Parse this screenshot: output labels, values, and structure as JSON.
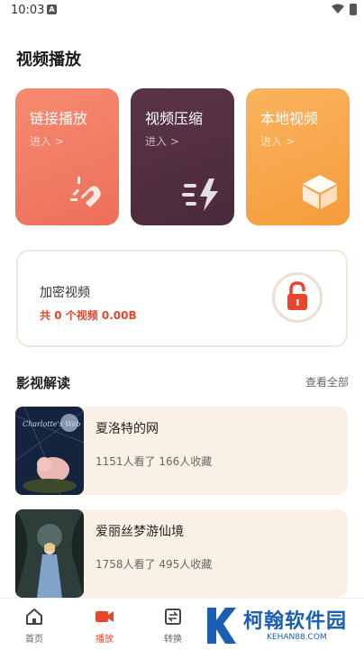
{
  "status": {
    "time": "10:03"
  },
  "video_section": {
    "title": "视频播放",
    "cards": [
      {
        "title": "链接播放",
        "sub": "进入 >",
        "icon": "magnet-icon",
        "color": "#f0765f"
      },
      {
        "title": "视频压缩",
        "sub": "进入 >",
        "icon": "lightning-icon",
        "color": "#502f40"
      },
      {
        "title": "本地视频",
        "sub": "进入 >",
        "icon": "cube-icon",
        "color": "#f8a64a"
      }
    ]
  },
  "encrypted": {
    "title": "加密视频",
    "stat": "共 0 个视频 0.00B",
    "icon": "lock-icon"
  },
  "film_section": {
    "title": "影视解读",
    "view_all": "查看全部",
    "items": [
      {
        "title": "夏洛特的网",
        "stat": "1151人看了 166人收藏",
        "poster_text": "Charlotte's Web"
      },
      {
        "title": "爱丽丝梦游仙境",
        "stat": "1758人看了 495人收藏"
      }
    ]
  },
  "tabbar": {
    "items": [
      {
        "label": "首页",
        "icon": "home-icon"
      },
      {
        "label": "播放",
        "icon": "video-icon",
        "active": true
      },
      {
        "label": "转换",
        "icon": "convert-icon"
      }
    ]
  },
  "watermark": {
    "text": "柯翰软件园",
    "sub": "KEHAN88.COM"
  },
  "colors": {
    "accent": "#e8452c",
    "card_bg": "#fbf0e6"
  }
}
